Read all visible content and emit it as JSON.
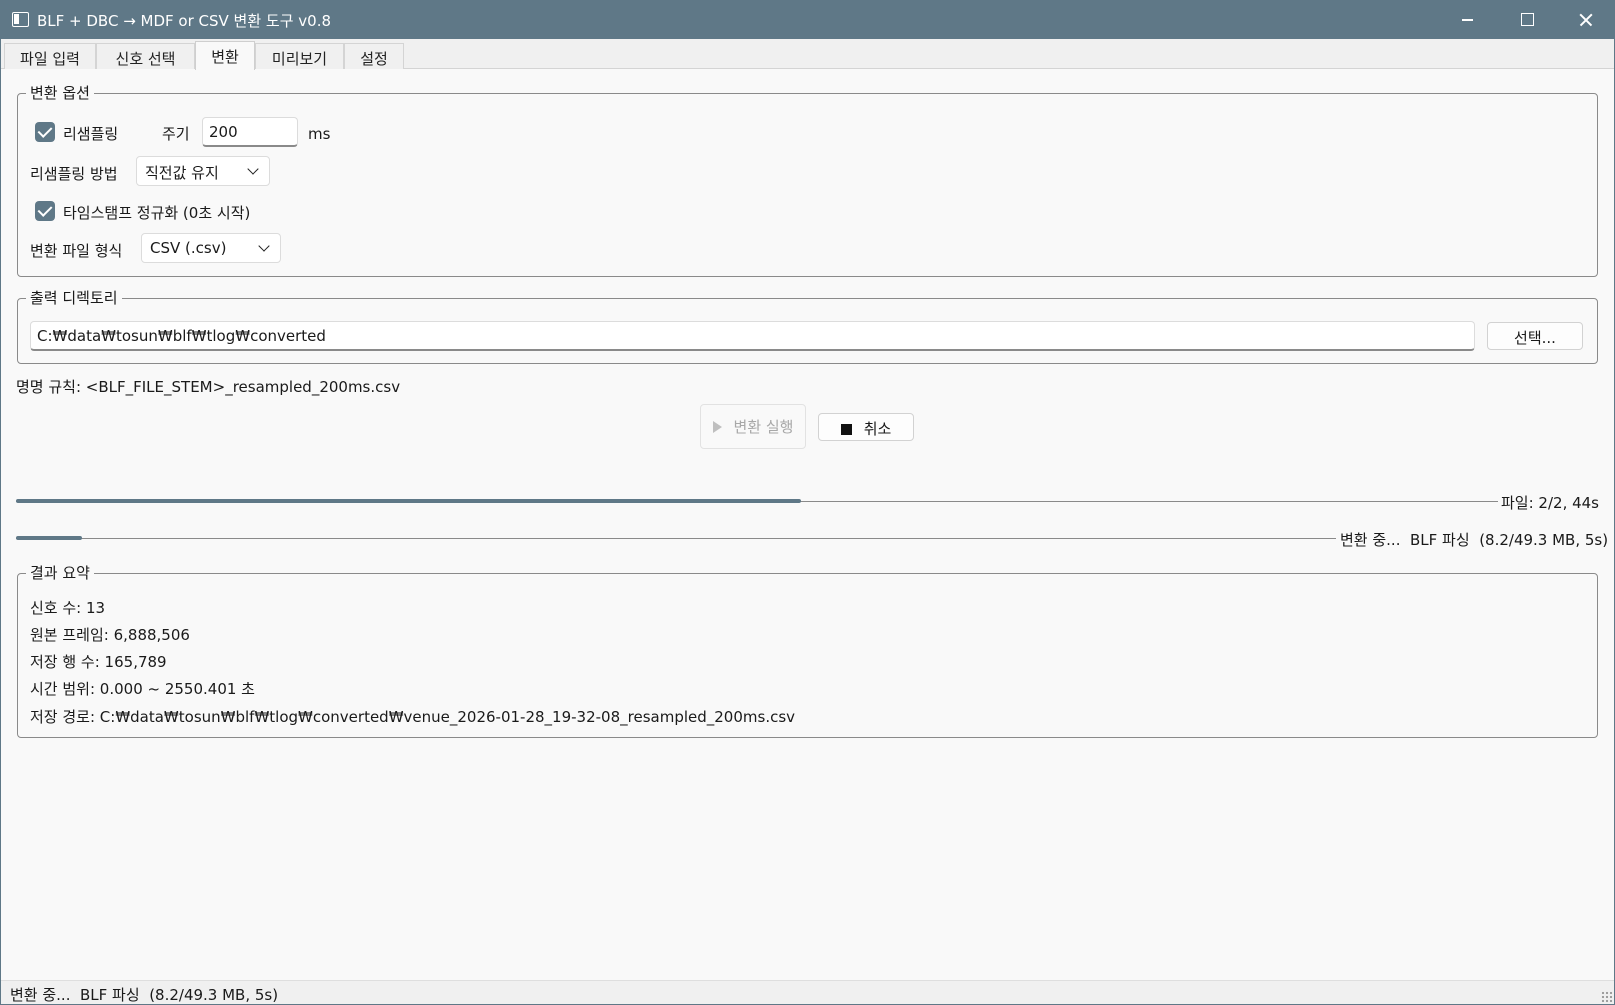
{
  "window": {
    "title": "BLF + DBC → MDF or CSV 변환 도구 v0.8",
    "icon": "app-window-icon"
  },
  "tabs": [
    {
      "label": "파일 입력",
      "active": false
    },
    {
      "label": "신호 선택",
      "active": false
    },
    {
      "label": "변환",
      "active": true
    },
    {
      "label": "미리보기",
      "active": false
    },
    {
      "label": "설정",
      "active": false
    }
  ],
  "options": {
    "group_label": "변환 옵션",
    "resample_label": "리샘플링",
    "resample_checked": true,
    "period_label": "주기",
    "period_value": "200",
    "period_unit": "ms",
    "method_label": "리샘플링 방법",
    "method_value": "직전값 유지",
    "normalize_label": "타임스탬프 정규화 (0초 시작)",
    "normalize_checked": true,
    "format_label": "변환 파일 형식",
    "format_value": "CSV (.csv)"
  },
  "output": {
    "group_label": "출력 디렉토리",
    "dir_value": "C:₩data₩tosun₩blf₩tlog₩converted",
    "select_label": "선택..."
  },
  "naming_rule": "명명 규칙: <BLF_FILE_STEM>_resampled_200ms.csv",
  "actions": {
    "run_label": "변환 실행",
    "run_enabled": false,
    "cancel_label": "취소"
  },
  "progress": {
    "overall_fraction": 0.53,
    "overall_text": "파일: 2/2, 44s",
    "current_fraction": 0.05,
    "current_text": "변환 중...  BLF 파싱  (8.2/49.3 MB, 5s)",
    "accent_color": "#5f7887"
  },
  "summary": {
    "group_label": "결과 요약",
    "lines": [
      "신호 수: 13",
      "원본 프레임: 6,888,506",
      "저장 행 수: 165,789",
      "시간 범위: 0.000 ~ 2550.401 초",
      "저장 경로: C:₩data₩tosun₩blf₩tlog₩converted₩venue_2026-01-28_19-32-08_resampled_200ms.csv"
    ]
  },
  "status_bar": {
    "text": "변환 중...  BLF 파싱  (8.2/49.3 MB, 5s)"
  }
}
